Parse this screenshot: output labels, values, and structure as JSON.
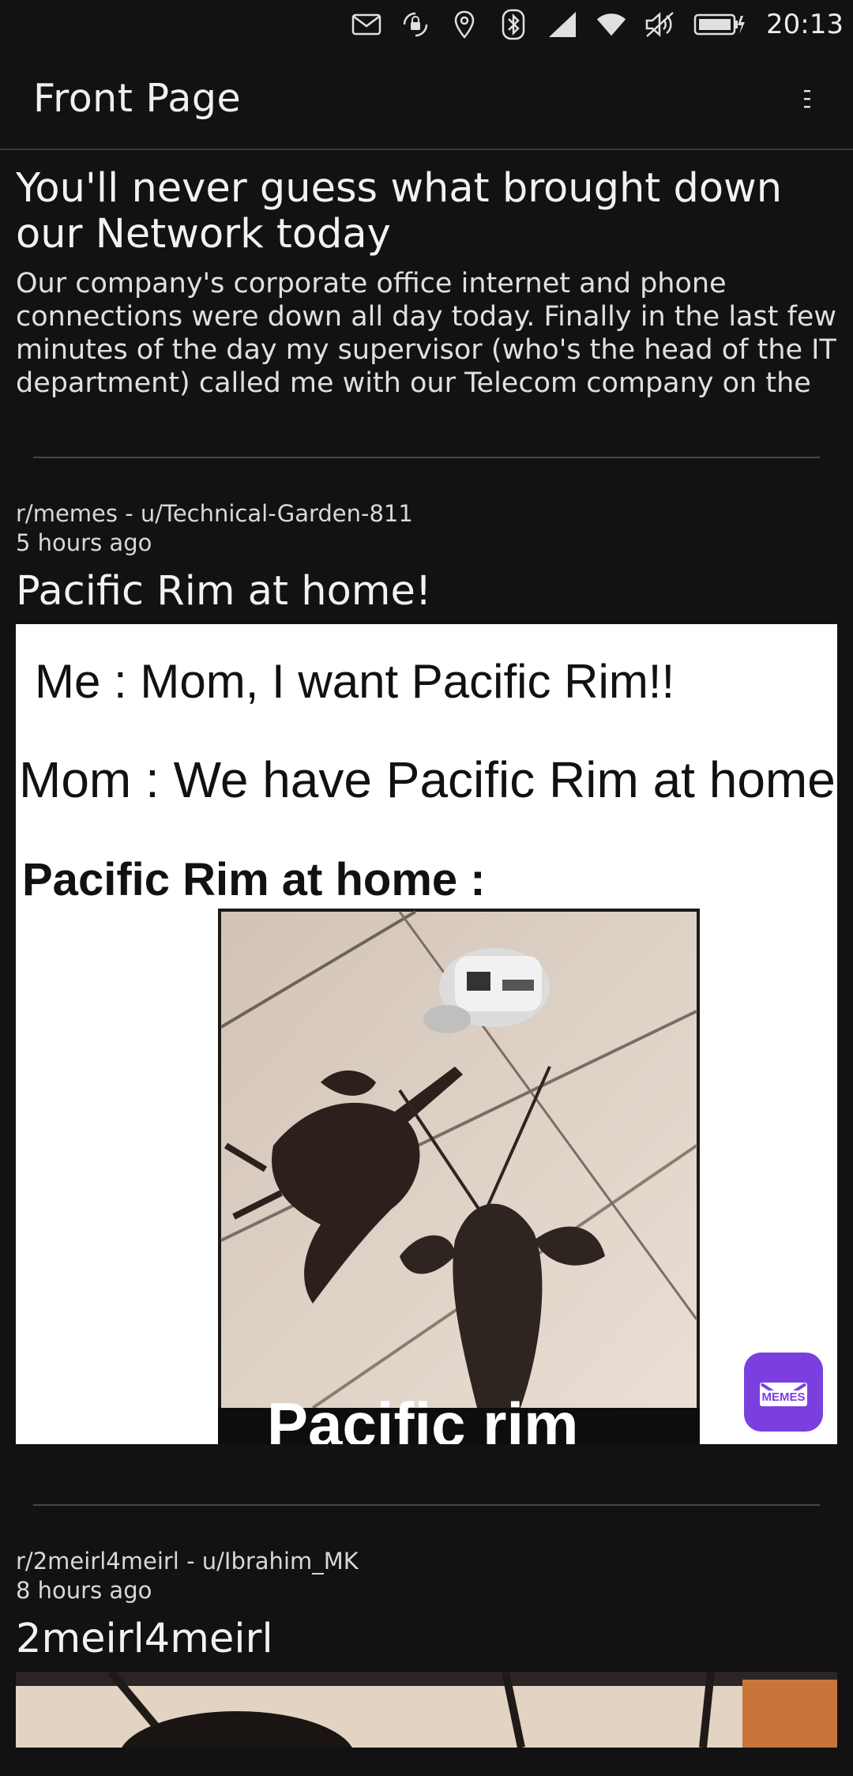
{
  "status_bar": {
    "time": "20:13",
    "icons": [
      "mail-icon",
      "screen-rotation-lock-icon",
      "location-icon",
      "bluetooth-icon",
      "cellular-signal-icon",
      "wifi-icon",
      "volume-muted-icon",
      "battery-charging-icon"
    ]
  },
  "header": {
    "title": "Front Page",
    "menu_icon": "overflow-menu-icon"
  },
  "posts": [
    {
      "title": "You'll never guess what brought down our Network today",
      "body": "Our company's corporate office internet and phone connections were down all day today.  Finally in the last few minutes of the day my supervisor (who's the head of the IT department) called me with our Telecom company on the lin…"
    },
    {
      "meta_line": "r/memes - u/Technical-Garden-811",
      "time": "5 hours ago",
      "title": "Pacific Rim at home!",
      "image": {
        "line1": "Me : Mom, I want Pacific Rim!!",
        "line2": "Mom : We have Pacific Rim at home!",
        "line3": "Pacific Rim at home :",
        "caption": "Pacific rim",
        "badge": "MEMES"
      }
    },
    {
      "meta_line": "r/2meirl4meirl - u/Ibrahim_MK",
      "time": "8 hours ago",
      "title": "2meirl4meirl"
    }
  ]
}
